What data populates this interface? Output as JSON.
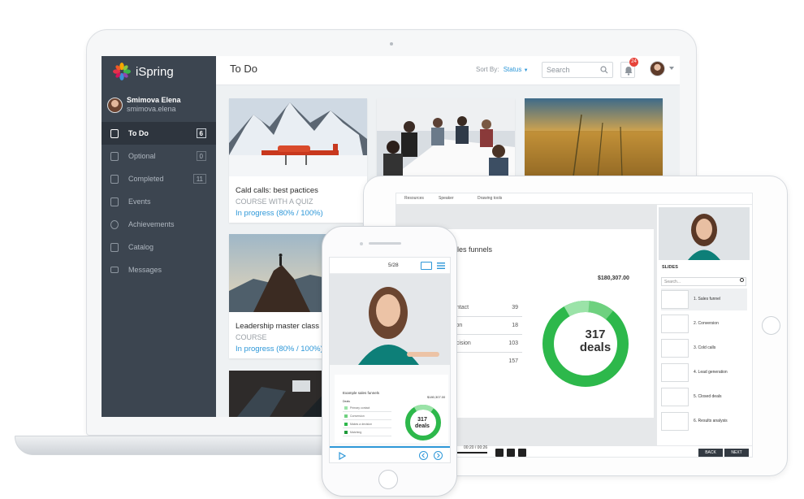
{
  "brand": {
    "name": "iSpring"
  },
  "user": {
    "name": "Smimova Elena",
    "login": "smimova.elena"
  },
  "menu": [
    {
      "label": "To Do",
      "count": "6",
      "icon": "calendar-icon",
      "active": true
    },
    {
      "label": "Optional",
      "count": "0",
      "icon": "document-icon"
    },
    {
      "label": "Completed",
      "count": "11",
      "icon": "checkbox-icon"
    },
    {
      "label": "Events",
      "count": "",
      "icon": "calendar-15-icon"
    },
    {
      "label": "Achievements",
      "count": "",
      "icon": "medal-icon"
    },
    {
      "label": "Catalog",
      "count": "",
      "icon": "catalog-icon"
    },
    {
      "label": "Messages",
      "count": "",
      "icon": "envelope-icon"
    }
  ],
  "header": {
    "title": "To Do",
    "sort_label": "Sort By:",
    "sort_value": "Status",
    "search_placeholder": "Search",
    "notification_count": "24"
  },
  "cards": [
    {
      "title": "Cald calls: best pactices",
      "subtitle": "COURSE WITH A QUIZ",
      "progress": "In progress (80% / 100%)"
    },
    {
      "title": "Leadership master class",
      "subtitle": "COURSE",
      "progress": "In progress (80% / 100%)"
    }
  ],
  "player": {
    "tabs": [
      "Resources",
      "Speaker",
      "Drawing tools"
    ],
    "slide_title": "ales funnels",
    "total": "$180,307.00",
    "rows": [
      {
        "label": "ontact",
        "value": "39"
      },
      {
        "label": "tion",
        "value": "18"
      },
      {
        "label": "ecision",
        "value": "103"
      },
      {
        "label": "",
        "value": "157"
      }
    ],
    "donut_number": "317",
    "donut_label": "deals",
    "slides_heading": "SLIDES",
    "search_placeholder": "Search...",
    "slides": [
      "1. Sales funnel",
      "2. Conversion",
      "3. Cold calls",
      "4. Lead generation",
      "5. Closed deals",
      "6. Results analysis"
    ],
    "time": "00:20 / 00:26",
    "back_label": "BACK",
    "next_label": "NEXT"
  },
  "phone": {
    "page": "5/28",
    "slide_title": "Example sales funnels",
    "total": "$180,307.00",
    "deals_label": "Deals",
    "rows": [
      "Primary contact",
      "Conversion",
      "Makes a decision",
      "Matching"
    ],
    "donut_number": "317",
    "donut_label": "deals"
  },
  "colors": {
    "accent": "#2d97d8",
    "sidebar": "#3c4550",
    "green": "#2db84b",
    "badge": "#e6433a"
  }
}
